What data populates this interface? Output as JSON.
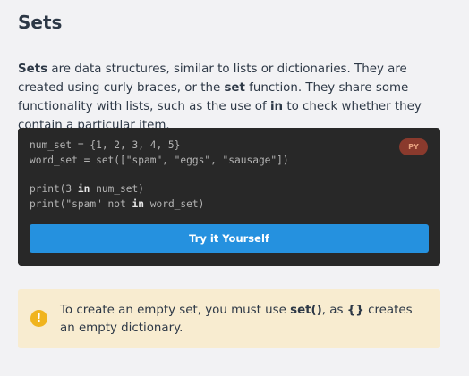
{
  "page": {
    "title": "Sets"
  },
  "intro": {
    "strong_sets": "Sets",
    "text_1": " are data structures, similar to lists or dictionaries. They are created using curly braces, or the ",
    "strong_set": "set",
    "text_2": " function. They share some functionality with lists, such as the use of ",
    "strong_in": "in",
    "text_3": " to check whether they contain a particular item."
  },
  "code_block": {
    "language_badge": "PY",
    "lines": {
      "l1": "num_set = {1, 2, 3, 4, 5}",
      "l2": "word_set = set([\"spam\", \"eggs\", \"sausage\"])",
      "l3_a": "print(3 ",
      "l3_kw": "in",
      "l3_b": " num_set)",
      "l4_a": "print(\"spam\" not ",
      "l4_kw": "in",
      "l4_b": " word_set)"
    },
    "try_button": "Try it Yourself"
  },
  "note": {
    "icon": "warning-icon",
    "icon_glyph": "!",
    "text_1": "To create an empty set, you must use ",
    "strong_set": "set()",
    "text_2": ", as ",
    "strong_braces": "{}",
    "text_3": " creates an empty dictionary."
  },
  "colors": {
    "background": "#f2f2f4",
    "code_bg": "#282828",
    "button": "#2591df",
    "badge": "#8a3a2d",
    "note_bg": "#f8ecd0",
    "warning": "#f0b41e"
  }
}
